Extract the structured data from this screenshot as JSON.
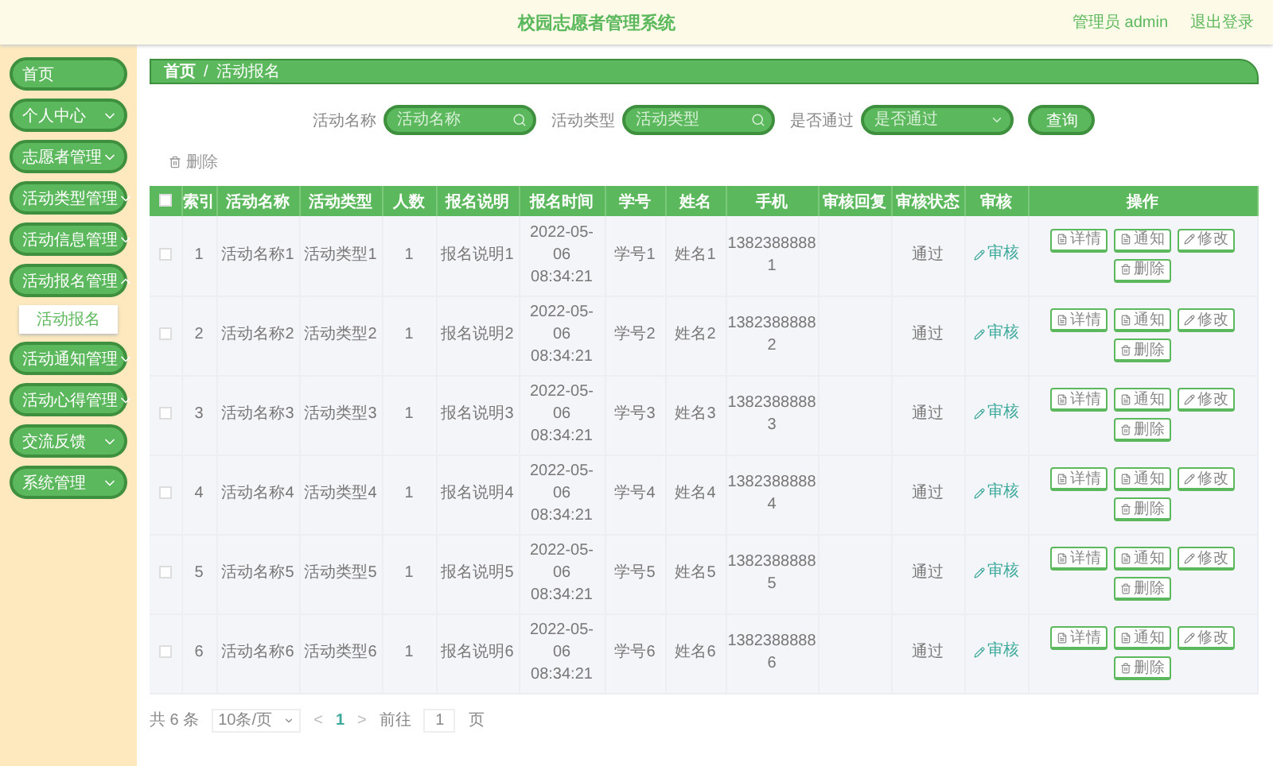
{
  "header": {
    "title": "校园志愿者管理系统",
    "user": "管理员 admin",
    "logout": "退出登录"
  },
  "sidebar": {
    "items": [
      {
        "label": "首页",
        "kind": "link"
      },
      {
        "label": "个人中心",
        "kind": "menu",
        "expanded": false
      },
      {
        "label": "志愿者管理",
        "kind": "menu",
        "expanded": false
      },
      {
        "label": "活动类型管理",
        "kind": "menu",
        "expanded": false
      },
      {
        "label": "活动信息管理",
        "kind": "menu",
        "expanded": false
      },
      {
        "label": "活动报名管理",
        "kind": "menu",
        "expanded": true,
        "children": [
          {
            "label": "活动报名",
            "selected": true
          }
        ]
      },
      {
        "label": "活动通知管理",
        "kind": "menu",
        "expanded": false
      },
      {
        "label": "活动心得管理",
        "kind": "menu",
        "expanded": false
      },
      {
        "label": "交流反馈",
        "kind": "menu",
        "expanded": false
      },
      {
        "label": "系统管理",
        "kind": "menu",
        "expanded": false
      }
    ]
  },
  "breadcrumb": {
    "items": [
      "首页",
      "活动报名"
    ],
    "separator": "/"
  },
  "search": {
    "fields": [
      {
        "label": "活动名称",
        "placeholder": "活动名称",
        "kind": "text"
      },
      {
        "label": "活动类型",
        "placeholder": "活动类型",
        "kind": "text"
      },
      {
        "label": "是否通过",
        "placeholder": "是否通过",
        "kind": "select"
      }
    ],
    "button": "查询"
  },
  "delete_button": "删除",
  "table": {
    "header_checked": false,
    "columns": [
      "索引",
      "活动名称",
      "活动类型",
      "人数",
      "报名说明",
      "报名时间",
      "学号",
      "姓名",
      "手机",
      "审核回复",
      "审核状态",
      "审核",
      "操作"
    ],
    "rows": [
      {
        "checked": false,
        "index": "1",
        "name": "活动名称1",
        "type": "活动类型1",
        "count": "1",
        "note": "报名说明1",
        "time": "2022-05-06 08:34:21",
        "student_no": "学号1",
        "student_name": "姓名1",
        "phone": "13823888881",
        "status": "通过",
        "review": "审核",
        "actions": [
          "详情",
          "通知",
          "修改",
          "删除"
        ]
      },
      {
        "checked": false,
        "index": "2",
        "name": "活动名称2",
        "type": "活动类型2",
        "count": "1",
        "note": "报名说明2",
        "time": "2022-05-06 08:34:21",
        "student_no": "学号2",
        "student_name": "姓名2",
        "phone": "13823888882",
        "status": "通过",
        "review": "审核",
        "actions": [
          "详情",
          "通知",
          "修改",
          "删除"
        ]
      },
      {
        "checked": false,
        "index": "3",
        "name": "活动名称3",
        "type": "活动类型3",
        "count": "1",
        "note": "报名说明3",
        "time": "2022-05-06 08:34:21",
        "student_no": "学号3",
        "student_name": "姓名3",
        "phone": "13823888883",
        "status": "通过",
        "review": "审核",
        "actions": [
          "详情",
          "通知",
          "修改",
          "删除"
        ]
      },
      {
        "checked": false,
        "index": "4",
        "name": "活动名称4",
        "type": "活动类型4",
        "count": "1",
        "note": "报名说明4",
        "time": "2022-05-06 08:34:21",
        "student_no": "学号4",
        "student_name": "姓名4",
        "phone": "13823888884",
        "status": "通过",
        "review": "审核",
        "actions": [
          "详情",
          "通知",
          "修改",
          "删除"
        ]
      },
      {
        "checked": false,
        "index": "5",
        "name": "活动名称5",
        "type": "活动类型5",
        "count": "1",
        "note": "报名说明5",
        "time": "2022-05-06 08:34:21",
        "student_no": "学号5",
        "student_name": "姓名5",
        "phone": "13823888885",
        "status": "通过",
        "review": "审核",
        "actions": [
          "详情",
          "通知",
          "修改",
          "删除"
        ]
      },
      {
        "checked": false,
        "index": "6",
        "name": "活动名称6",
        "type": "活动类型6",
        "count": "1",
        "note": "报名说明6",
        "time": "2022-05-06 08:34:21",
        "student_no": "学号6",
        "student_name": "姓名6",
        "phone": "13823888886",
        "status": "通过",
        "review": "审核",
        "actions": [
          "详情",
          "通知",
          "修改",
          "删除"
        ]
      }
    ]
  },
  "pagination": {
    "total": "共 6 条",
    "page_size": "10条/页",
    "prev": "<",
    "pages": [
      {
        "label": "1",
        "selected": true
      }
    ],
    "next": ">",
    "goto_label": "前往",
    "goto_value": "1",
    "goto_suffix": "页"
  }
}
